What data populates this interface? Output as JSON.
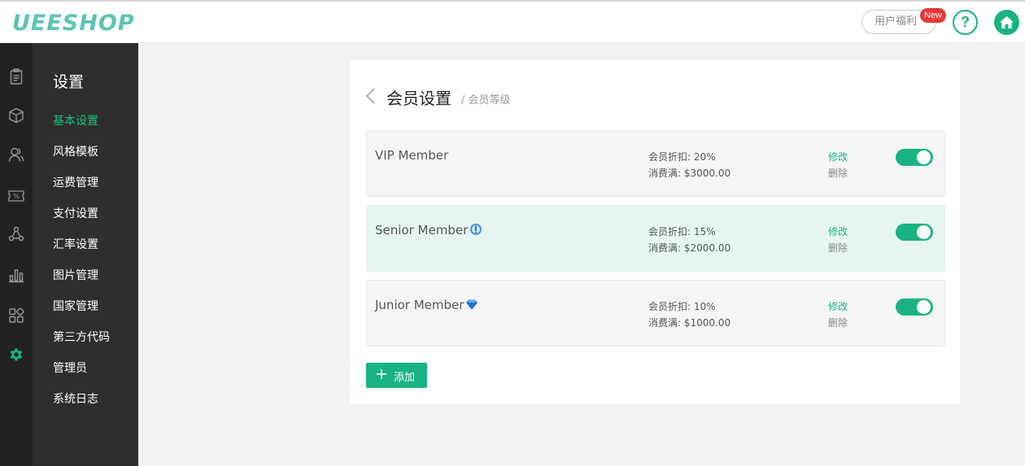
{
  "header": {
    "logo": "UEESHOP",
    "welfare_label": "用户福利",
    "new_badge": "New",
    "help_label": "?"
  },
  "rail": {
    "icons": [
      "orders-icon",
      "products-icon",
      "users-icon",
      "coupon-icon",
      "share-network-icon",
      "stats-icon",
      "apps-icon",
      "settings-gear-icon"
    ],
    "active_color": "#19b383"
  },
  "menu": {
    "title": "设置",
    "items": [
      {
        "label": "基本设置",
        "active": true
      },
      {
        "label": "风格模板"
      },
      {
        "label": "运费管理"
      },
      {
        "label": "支付设置"
      },
      {
        "label": "汇率设置"
      },
      {
        "label": "图片管理"
      },
      {
        "label": "国家管理"
      },
      {
        "label": "第三方代码"
      },
      {
        "label": "管理员"
      },
      {
        "label": "系统日志"
      }
    ]
  },
  "page": {
    "title": "会员设置",
    "breadcrumb": "/ 会员等级"
  },
  "levels": [
    {
      "name": "VIP Member",
      "discount": "会员折扣: 20%",
      "spend": "消费满: $3000.00",
      "edit": "修改",
      "delete": "删除",
      "enabled": true,
      "badge": ""
    },
    {
      "name": "Senior Member",
      "discount": "会员折扣: 15%",
      "spend": "消费满: $2000.00",
      "edit": "修改",
      "delete": "删除",
      "enabled": true,
      "badge": "medal-icon"
    },
    {
      "name": "Junior Member",
      "discount": "会员折扣: 10%",
      "spend": "消费满: $1000.00",
      "edit": "修改",
      "delete": "删除",
      "enabled": true,
      "badge": "diamond-icon"
    }
  ],
  "add_button": "添加",
  "colors": {
    "accent": "#19b383",
    "logo": "#5dc4b3",
    "badge_red": "#e53935",
    "highlight_row": "#e6f5f0"
  }
}
